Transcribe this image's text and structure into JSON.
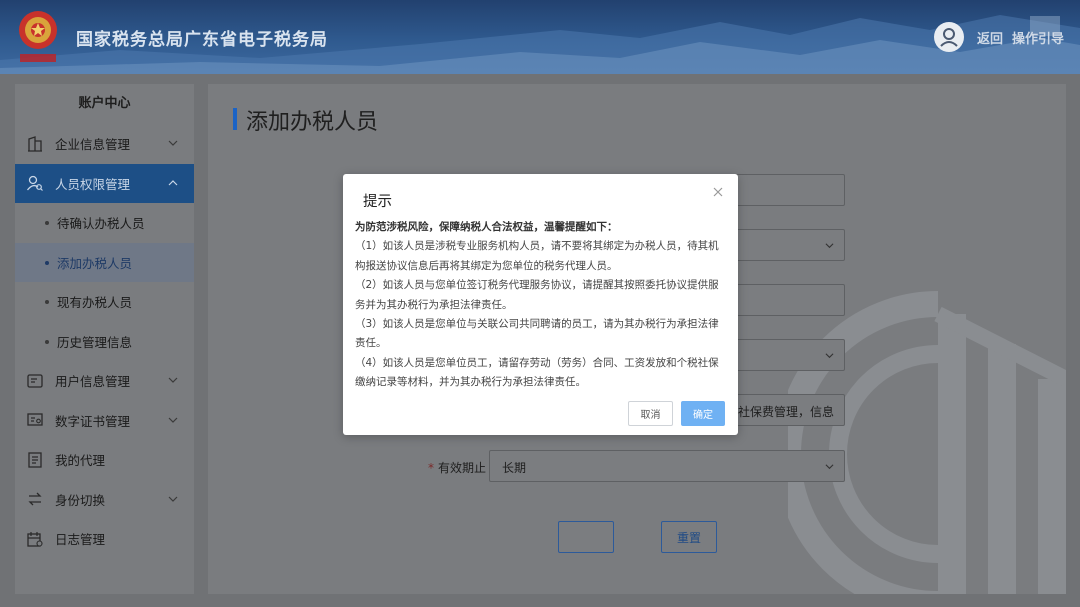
{
  "header": {
    "site_title": "国家税务总局广东省电子税务局",
    "back_label": "返回",
    "guide_label": "操作引导"
  },
  "sidebar": {
    "title": "账户中心",
    "items": [
      {
        "label": "企业信息管理",
        "icon": "building-icon"
      },
      {
        "label": "人员权限管理",
        "icon": "user-search-icon"
      },
      {
        "label": "用户信息管理",
        "icon": "id-card-icon"
      },
      {
        "label": "数字证书管理",
        "icon": "certificate-icon"
      },
      {
        "label": "我的代理",
        "icon": "document-list-icon"
      },
      {
        "label": "身份切换",
        "icon": "switch-icon"
      },
      {
        "label": "日志管理",
        "icon": "calendar-log-icon"
      }
    ],
    "sub_items": [
      {
        "label": "待确认办税人员"
      },
      {
        "label": "添加办税人员"
      },
      {
        "label": "现有办税人员"
      },
      {
        "label": "历史管理信息"
      }
    ]
  },
  "main": {
    "page_title": "添加办税人员",
    "form": {
      "permission_partial": "，社保费管理，信息",
      "validity_label": "有效期止",
      "required_mark": "*",
      "validity_value": "长期",
      "reset_label": "重置"
    }
  },
  "modal": {
    "title": "提示",
    "lead": "为防范涉税风险，保障纳税人合法权益，温馨提醒如下：",
    "points": [
      "（1）如该人员是涉税专业服务机构人员，请不要将其绑定为办税人员，待其机构报送协议信息后再将其绑定为您单位的税务代理人员。",
      "（2）如该人员与您单位签订税务代理服务协议，请提醒其按照委托协议提供服务并为其办税行为承担法律责任。",
      "（3）如该人员是您单位与关联公司共同聘请的员工，请为其办税行为承担法律责任。",
      "（4）如该人员是您单位员工，请留存劳动（劳务）合同、工资发放和个税社保缴纳记录等材料，并为其办税行为承担法律责任。"
    ],
    "cancel_label": "取消",
    "ok_label": "确定"
  },
  "colors": {
    "accent": "#1b63c5",
    "active_menu": "#1d4f86",
    "ok_button": "#6fb1f3"
  }
}
